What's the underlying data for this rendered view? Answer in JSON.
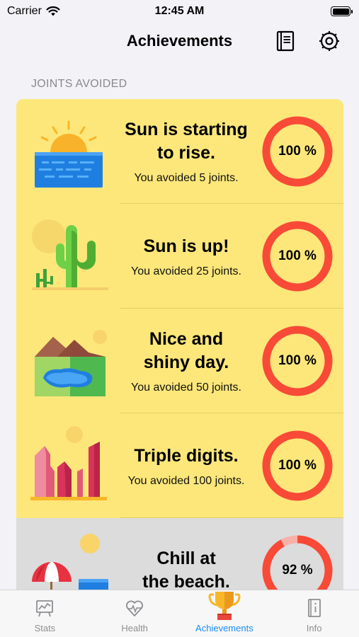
{
  "status_bar": {
    "carrier": "Carrier",
    "time": "12:45 AM"
  },
  "nav": {
    "title": "Achievements"
  },
  "section": {
    "header": "JOINTS AVOIDED"
  },
  "achievements": [
    {
      "title_line1": "Sun is starting",
      "title_line2": "to rise.",
      "subtitle": "You avoided 5 joints.",
      "progress_label": "100 %",
      "progress": 1.0
    },
    {
      "title_line1": "Sun is up!",
      "title_line2": "",
      "subtitle": "You avoided 25 joints.",
      "progress_label": "100 %",
      "progress": 1.0
    },
    {
      "title_line1": "Nice and",
      "title_line2": "shiny day.",
      "subtitle": "You avoided 50 joints.",
      "progress_label": "100 %",
      "progress": 1.0
    },
    {
      "title_line1": "Triple digits.",
      "title_line2": "",
      "subtitle": "You avoided 100 joints.",
      "progress_label": "100 %",
      "progress": 1.0
    },
    {
      "title_line1": "Chill at",
      "title_line2": "the beach.",
      "subtitle": "",
      "progress_label": "92 %",
      "progress": 0.92
    }
  ],
  "tabs": [
    {
      "label": "Stats",
      "icon": "stats-icon",
      "active": false
    },
    {
      "label": "Health",
      "icon": "health-icon",
      "active": false
    },
    {
      "label": "Achievements",
      "icon": "trophy-icon",
      "active": true
    },
    {
      "label": "Info",
      "icon": "info-book-icon",
      "active": false
    }
  ],
  "colors": {
    "card_complete": "#fde77a",
    "card_partial": "#dcdcdc",
    "ring": "#f84a37",
    "ring_track": "#f8b1a8",
    "accent": "#1a8cff"
  }
}
